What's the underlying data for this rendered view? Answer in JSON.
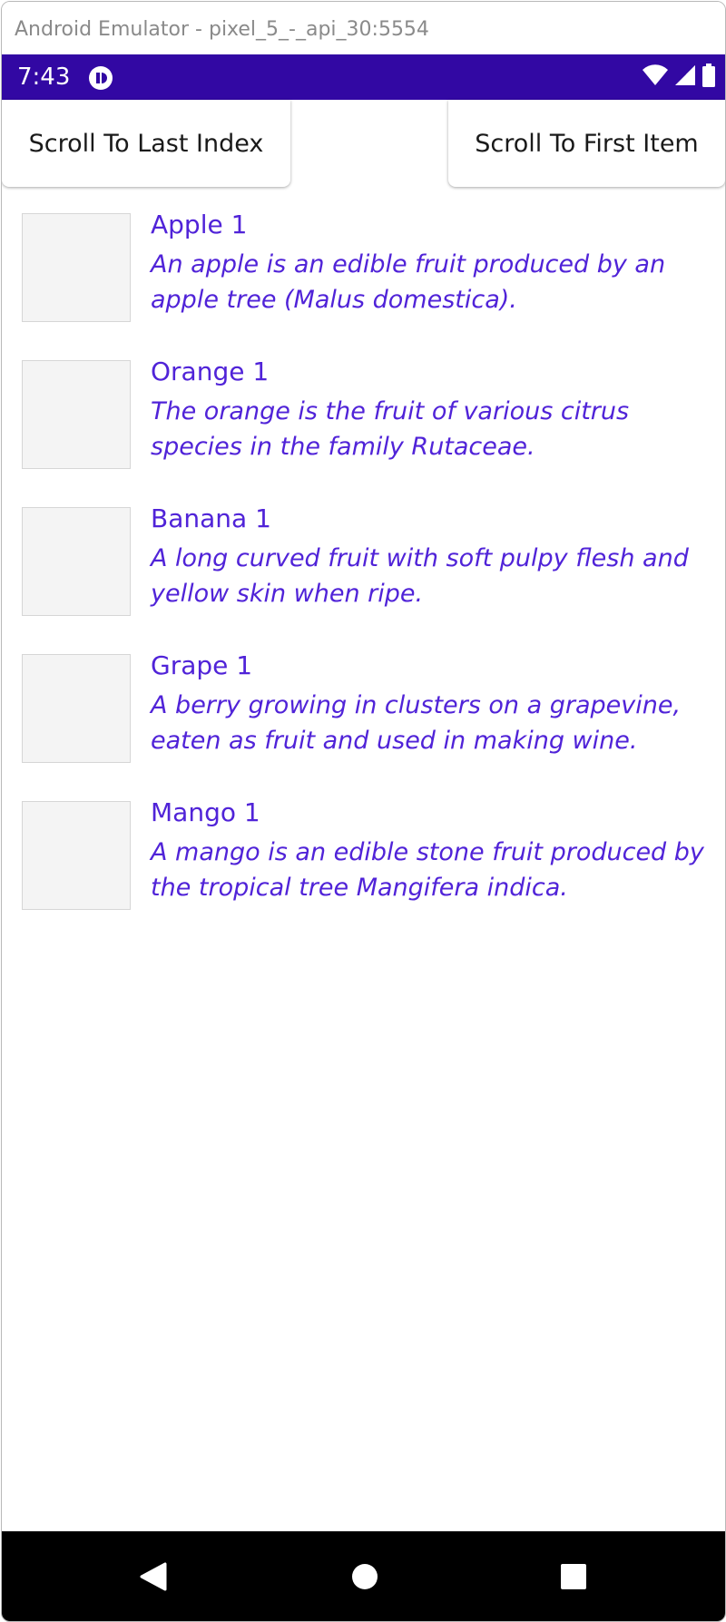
{
  "window": {
    "title": "Android Emulator - pixel_5_-_api_30:5554"
  },
  "status_bar": {
    "time": "7:43",
    "background_color": "#3208A3",
    "icons": [
      "app-notification-icon",
      "wifi-icon",
      "cellular-signal-icon",
      "battery-icon"
    ]
  },
  "toolbar": {
    "scroll_last_label": "Scroll To Last Index",
    "scroll_first_label": "Scroll To First Item"
  },
  "accent_color": "#5023D8",
  "items": [
    {
      "title": "Apple 1",
      "description": "An apple is an edible fruit produced by an apple tree (Malus domestica)."
    },
    {
      "title": "Orange 1",
      "description": "The orange is the fruit of various citrus species in the family Rutaceae."
    },
    {
      "title": "Banana 1",
      "description": "A long curved fruit with soft pulpy flesh and yellow skin when ripe."
    },
    {
      "title": "Grape 1",
      "description": "A berry growing in clusters on a grapevine, eaten as fruit and used in making wine."
    },
    {
      "title": "Mango 1",
      "description": "A mango is an edible stone fruit produced by the tropical tree Mangifera indica."
    }
  ],
  "navigation": {
    "buttons": [
      "back-icon",
      "home-icon",
      "recents-icon"
    ]
  }
}
